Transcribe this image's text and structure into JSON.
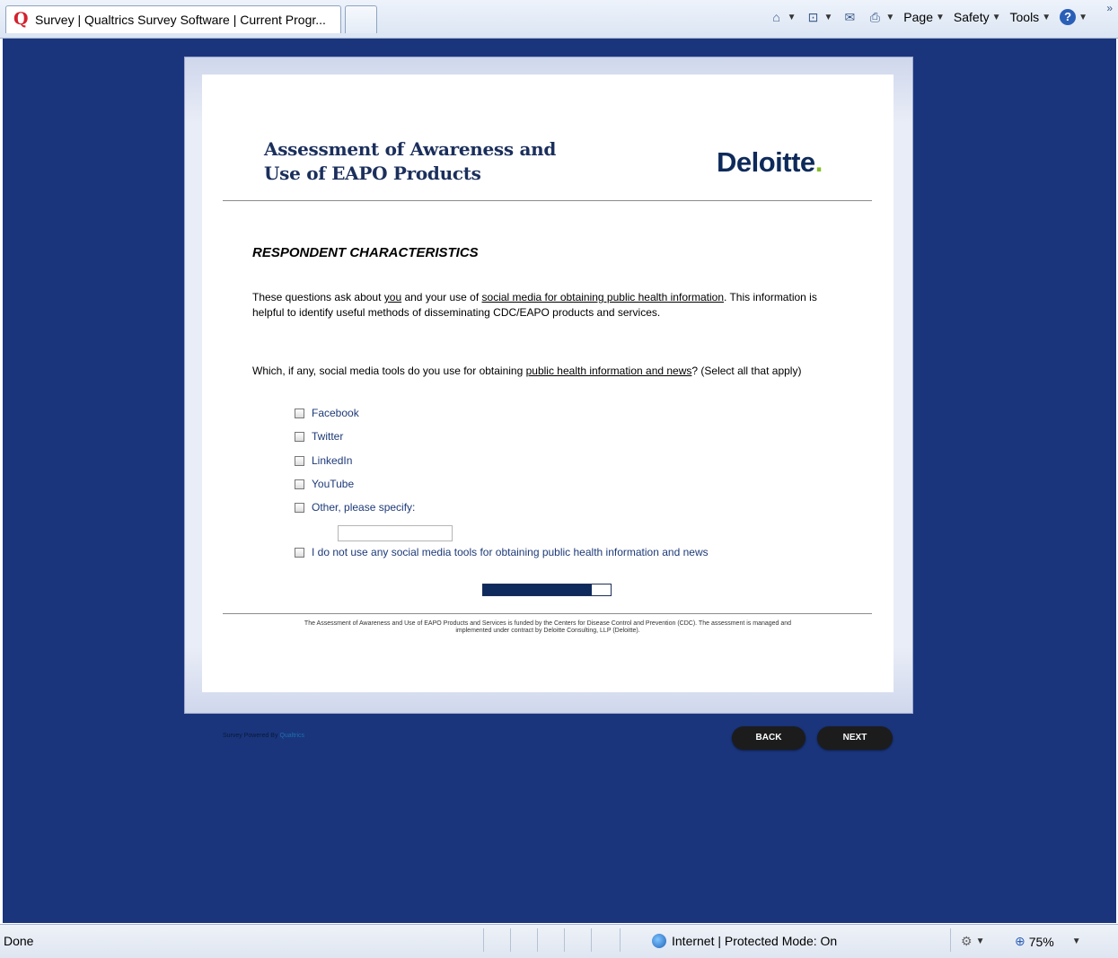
{
  "browser": {
    "tab_title": "Survey | Qualtrics Survey Software | Current Progr...",
    "tab_icon_letter": "Q",
    "commands": [
      {
        "label": "Page"
      },
      {
        "label": "Safety"
      },
      {
        "label": "Tools"
      }
    ],
    "status_text": "Done",
    "zone_text": "Internet | Protected Mode: On",
    "zoom_text": "75%"
  },
  "survey": {
    "title_line1": "Assessment of Awareness and",
    "title_line2": "Use of EAPO Products",
    "logo_text": "Deloitte",
    "logo_dot": ".",
    "logo_dot_color": "#86bc25",
    "section_title": "RESPONDENT CHARACTERISTICS",
    "intro": {
      "part1": "These questions ask about ",
      "u1": "you",
      "part2": " and your use of ",
      "u2": "social media for obtaining public health information",
      "part3": ". This information is helpful to identify useful methods of disseminating CDC/EAPO products and services."
    },
    "question": {
      "part1": "Which, if any, social media tools do you use for obtaining ",
      "u1": "public health information and news",
      "part2": "? (Select all that apply)"
    },
    "options": [
      {
        "label": "Facebook",
        "checked": false
      },
      {
        "label": "Twitter",
        "checked": false
      },
      {
        "label": "LinkedIn",
        "checked": false
      },
      {
        "label": "YouTube",
        "checked": false
      },
      {
        "label": "Other, please specify:",
        "checked": false
      },
      {
        "label": "I do not use any social media tools for obtaining public health information and news",
        "checked": false
      }
    ],
    "other_input_value": "",
    "progress_fraction": 0.85,
    "footnote": "The Assessment of Awareness and Use of EAPO Products and Services is funded by the Centers for Disease Control and Prevention (CDC). The assessment is managed and implemented under contract by Deloitte Consulting, LLP (Deloitte).",
    "powered_by": "Survey Powered By",
    "powered_by_link": "Qualtrics",
    "back_label": "BACK",
    "next_label": "NEXT"
  },
  "colors": {
    "page_background": "#1a357c",
    "title_navy": "#1b2f5c",
    "button_dark": "#1c1c1c"
  }
}
